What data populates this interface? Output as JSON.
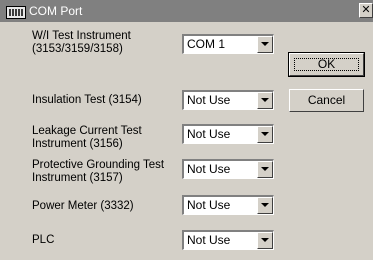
{
  "window": {
    "title": "COM Port",
    "close_label": "✕"
  },
  "fields": [
    {
      "label_lines": [
        "W/I Test Instrument",
        "(3153/3159/3158)"
      ],
      "value": "COM 1"
    },
    {
      "label_lines": [
        "Insulation Test (3154)"
      ],
      "value": "Not Use"
    },
    {
      "label_lines": [
        "Leakage Current Test",
        "Instrument (3156)"
      ],
      "value": "Not Use"
    },
    {
      "label_lines": [
        "Protective Grounding Test",
        "Instrument (3157)"
      ],
      "value": "Not Use"
    },
    {
      "label_lines": [
        "Power Meter (3332)"
      ],
      "value": "Not Use"
    },
    {
      "label_lines": [
        "PLC"
      ],
      "value": "Not Use"
    }
  ],
  "buttons": {
    "ok_label": "OK",
    "cancel_label": "Cancel"
  },
  "icons": {
    "app": "keyboard-icon",
    "close": "close-icon",
    "dropdown": "chevron-down-icon"
  }
}
